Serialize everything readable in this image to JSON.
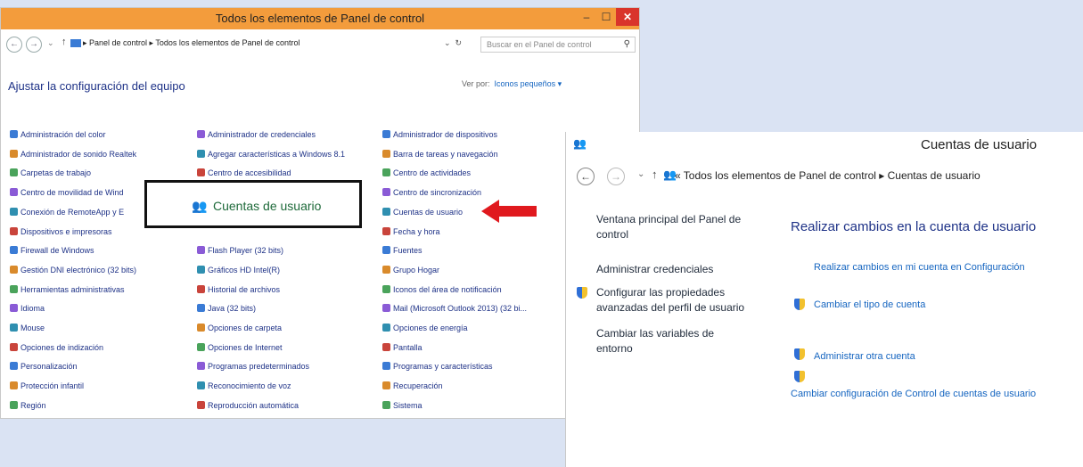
{
  "cp_window": {
    "title": "Todos los elementos de Panel de control",
    "min": "–",
    "max": "☐",
    "close": "✕",
    "breadcrumb": "▸ Panel de control  ▸  Todos los elementos de Panel de control",
    "search_placeholder": "Buscar en el Panel de control",
    "heading": "Ajustar la configuración del equipo",
    "view_by_label": "Ver por:",
    "view_by_value": "Iconos pequeños ▾",
    "columns": [
      [
        "Administración del color",
        "Administrador de sonido Realtek",
        "Carpetas de trabajo",
        "Centro de movilidad de Wind",
        "Conexión de RemoteApp y E",
        "Dispositivos e impresoras",
        "Firewall de Windows",
        "Gestión DNI electrónico (32 bits)",
        "Herramientas administrativas",
        "Idioma",
        "Mouse",
        "Opciones de indización",
        "Personalización",
        "Protección infantil",
        "Región"
      ],
      [
        "Administrador de credenciales",
        "Agregar características a Windows 8.1",
        "Centro de accesibilidad",
        "",
        "",
        "",
        "Flash Player (32 bits)",
        "Gráficos HD Intel(R)",
        "Historial de archivos",
        "Java (32 bits)",
        "Opciones de carpeta",
        "Opciones de Internet",
        "Programas predeterminados",
        "Reconocimiento de voz",
        "Reproducción automática"
      ],
      [
        "Administrador de dispositivos",
        "Barra de tareas y navegación",
        "Centro de actividades",
        "Centro de sincronización",
        "Cuentas de usuario",
        "Fecha y hora",
        "Fuentes",
        "Grupo Hogar",
        "Iconos del área de notificación",
        "Mail (Microsoft Outlook 2013) (32 bi...",
        "Opciones de energía",
        "Pantalla",
        "Programas y características",
        "Recuperación",
        "Sistema"
      ]
    ],
    "callout_label": "Cuentas de usuario"
  },
  "ua_window": {
    "title": "Cuentas de usuario",
    "breadcrumb": "«  Todos los elementos de Panel de control  ▸  Cuentas de usuario",
    "left_links": [
      "Ventana principal del Panel de control",
      "Administrar credenciales",
      "Configurar las propiedades avanzadas del perfil de usuario",
      "Cambiar las variables de entorno"
    ],
    "main_heading": "Realizar cambios en la cuenta de usuario",
    "main_links": [
      "Realizar cambios en mi cuenta en Configuración",
      "Cambiar el tipo de cuenta",
      "Administrar otra cuenta",
      "Cambiar configuración de Control de cuentas de usuario"
    ]
  },
  "colors": {
    "link": "#1e3287",
    "accent_title": "#f39c3c",
    "arrow": "#e0191e"
  }
}
